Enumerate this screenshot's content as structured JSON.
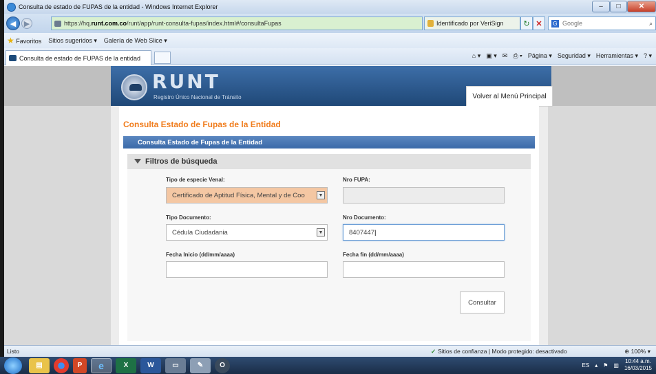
{
  "window": {
    "title": "Consulta de estado de FUPAS de la entidad - Windows Internet Explorer"
  },
  "address": {
    "url_prefix": "https://hq.",
    "url_domain": "runt.com.co",
    "url_path": "/runt/app/runt-consulta-fupas/index.html#/consultaFupas",
    "cert": "Identificado por VeriSign",
    "search_placeholder": "Google"
  },
  "favorites": {
    "label": "Favoritos",
    "items": [
      "Sitios sugeridos ▾",
      "Galería de Web Slice ▾"
    ]
  },
  "tab": {
    "label": "Consulta de estado de FUPAS de la entidad"
  },
  "commands": [
    "Página ▾",
    "Seguridad ▾",
    "Herramientas ▾"
  ],
  "page": {
    "logo_text": "RUNT",
    "logo_sub": "Registro Único Nacional de Tránsito",
    "menu_button": "Volver al Menú Principal",
    "title": "Consulta Estado de Fupas de la Entidad",
    "section": "Consulta Estado de Fupas de la Entidad",
    "filters": "Filtros de búsqueda",
    "form": {
      "species_label": "Tipo de especie Venal:",
      "species_value": "Certificado de Aptitud Física, Mental y de Coo",
      "fupa_label": "Nro FUPA:",
      "fupa_value": "",
      "doctype_label": "Tipo Documento:",
      "doctype_value": "Cédula Ciudadania",
      "docnum_label": "Nro Documento:",
      "docnum_value": "8407447",
      "start_label": "Fecha Inicio (dd/mm/aaaa)",
      "start_value": "",
      "end_label": "Fecha fin (dd/mm/aaaa)",
      "end_value": "",
      "submit": "Consultar"
    }
  },
  "status": {
    "left": "Listo",
    "zone": "Sitios de confianza | Modo protegido: desactivado",
    "zoom": "100%"
  },
  "taskbar": {
    "lang": "ES",
    "time": "10:44 a.m.",
    "date": "16/03/2015",
    "apps": [
      "explorer",
      "chrome",
      "powerpoint",
      "ie",
      "excel",
      "word",
      "folder",
      "paint",
      "opera"
    ]
  }
}
